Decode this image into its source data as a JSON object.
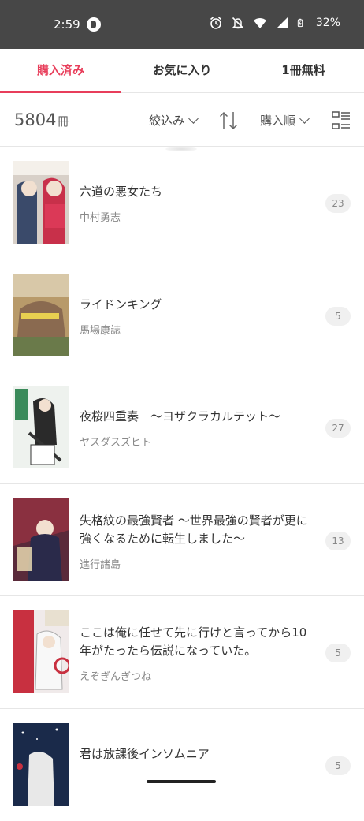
{
  "status": {
    "time": "2:59",
    "battery": "32%"
  },
  "tabs": [
    {
      "label": "購入済み",
      "active": true
    },
    {
      "label": "お気に入り",
      "active": false
    },
    {
      "label": "1冊無料",
      "active": false
    }
  ],
  "toolbar": {
    "count": "5804",
    "count_unit": "冊",
    "filter_label": "絞込み",
    "order_label": "購入順"
  },
  "books": [
    {
      "title": "六道の悪女たち",
      "author": "中村勇志",
      "count": "23",
      "cover_color": "#d8d0c8"
    },
    {
      "title": "ライドンキング",
      "author": "馬場康誌",
      "count": "5",
      "cover_color": "#b89a6a"
    },
    {
      "title": "夜桜四重奏　～ヨザクラカルテット～",
      "author": "ヤスダスズヒト",
      "count": "27",
      "cover_color": "#e8f0e8"
    },
    {
      "title": "失格紋の最強賢者 ～世界最強の賢者が更に強くなるために転生しました～",
      "author": "進行諸島",
      "count": "13",
      "cover_color": "#5a2a3a"
    },
    {
      "title": "ここは俺に任せて先に行けと言ってから10年がたったら伝説になっていた。",
      "author": "えぞぎんぎつね",
      "count": "5",
      "cover_color": "#c83040"
    },
    {
      "title": "君は放課後インソムニア",
      "author": "",
      "count": "5",
      "cover_color": "#1a2a4a"
    }
  ],
  "colors": {
    "accent": "#e83e5b",
    "status_bar": "#474747"
  }
}
